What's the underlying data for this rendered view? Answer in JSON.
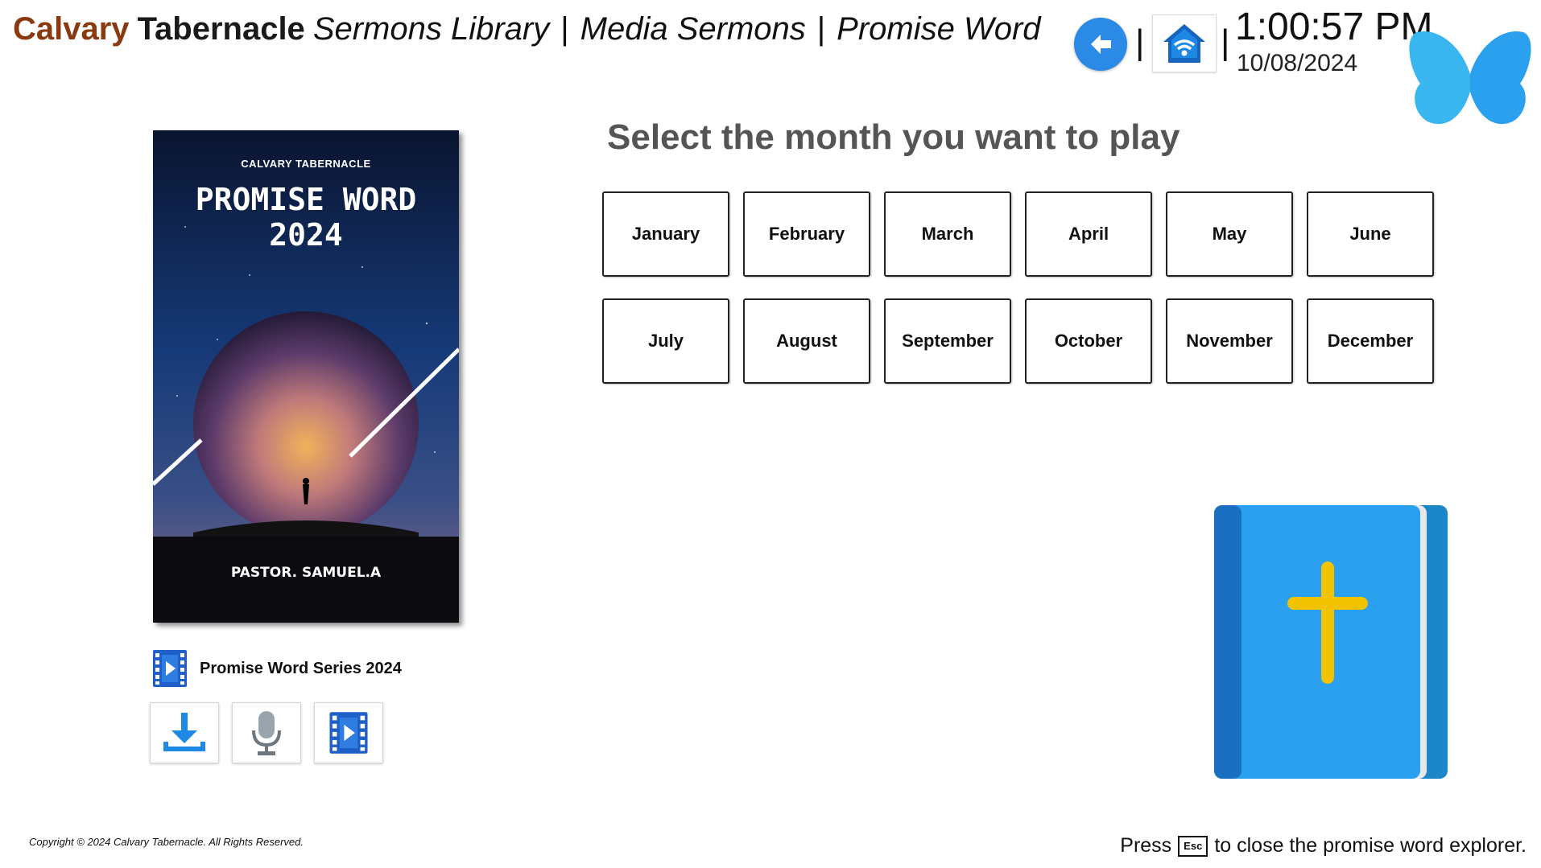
{
  "header": {
    "brand_part1": "Calvary",
    "brand_part2": "Tabernacle",
    "crumbs": [
      "Sermons Library",
      "Media Sermons",
      "Promise Word"
    ]
  },
  "clock": {
    "time": "1:00:57 PM",
    "date": "10/08/2024"
  },
  "nav": {
    "back_icon": "back-arrow-icon",
    "home_icon": "home-wifi-icon"
  },
  "cover": {
    "top_text": "CALVARY TABERNACLE",
    "title": "PROMISE WORD 2024",
    "author": "PASTOR. SAMUEL.A"
  },
  "series": {
    "label": "Promise Word Series 2024",
    "icon": "video-file-icon"
  },
  "tools": [
    {
      "name": "download",
      "icon": "download-icon"
    },
    {
      "name": "audio",
      "icon": "microphone-icon"
    },
    {
      "name": "video",
      "icon": "video-file-icon"
    }
  ],
  "main": {
    "heading": "Select the month you want to play",
    "months": [
      "January",
      "February",
      "March",
      "April",
      "May",
      "June",
      "July",
      "August",
      "September",
      "October",
      "November",
      "December"
    ]
  },
  "footer": {
    "copyright": "Copyright © 2024 Calvary Tabernacle. All Rights Reserved.",
    "hint_press": "Press",
    "hint_key": "Esc",
    "hint_rest": "to close the promise word explorer."
  },
  "colors": {
    "brand_brown": "#8b3a0f",
    "accent_blue": "#2a8ae6",
    "bible_blue": "#2aa0ee",
    "cross_yellow": "#f2c300"
  }
}
